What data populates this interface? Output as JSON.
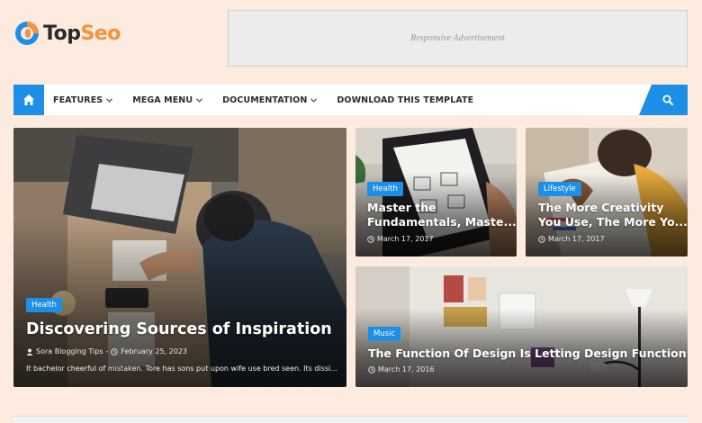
{
  "header": {
    "logo": {
      "part1": "Top",
      "part2": "Seo"
    },
    "ad_text": "Responsive Advertisement"
  },
  "nav": {
    "items": [
      {
        "label": "FEATURES",
        "has_dropdown": true
      },
      {
        "label": "MEGA MENU",
        "has_dropdown": true
      },
      {
        "label": "DOCUMENTATION",
        "has_dropdown": true
      },
      {
        "label": "DOWNLOAD THIS TEMPLATE",
        "has_dropdown": false
      }
    ],
    "icons": {
      "home": "home-icon",
      "search": "search-icon"
    }
  },
  "posts": [
    {
      "category": "Health",
      "title": "Discovering Sources of Inspiration",
      "author": "Sora Blogging Tips",
      "date": "February 25, 2023",
      "excerpt": "It bachelor cheerful of mistaken. Tore has sons put upon wife use bred seen. Its dissi..."
    },
    {
      "category": "Health",
      "title_line1": "Master the",
      "title_line2": "Fundamentals, Maste...",
      "date": "March 17, 2017"
    },
    {
      "category": "Lifestyle",
      "title_line1": "The More Creativity",
      "title_line2": "You Use, The More Yo...",
      "date": "March 17, 2017"
    },
    {
      "category": "Music",
      "title": "The Function Of Design Is Letting Design Function",
      "date": "March 17, 2016"
    }
  ],
  "colors": {
    "accent": "#1e8fe6",
    "brand_orange": "#f5923e",
    "header_bg": "#fdebe0"
  }
}
